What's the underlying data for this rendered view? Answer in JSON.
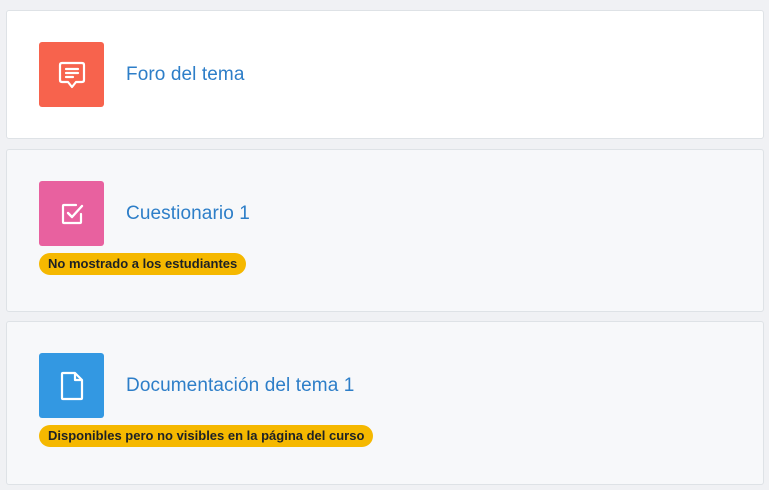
{
  "activities": [
    {
      "title": "Foro del tema",
      "icon": "forum-icon",
      "icon_color": "#f7634d",
      "badge": null
    },
    {
      "title": "Cuestionario 1",
      "icon": "quiz-icon",
      "icon_color": "#e8619f",
      "badge": "No mostrado a los estudiantes"
    },
    {
      "title": "Documentación del tema 1",
      "icon": "file-icon",
      "icon_color": "#3398e2",
      "badge": "Disponibles pero no visibles en la página del curso"
    }
  ],
  "colors": {
    "link": "#2d7ec8",
    "badge_bg": "#f5b800",
    "badge_text": "#1d2125"
  }
}
